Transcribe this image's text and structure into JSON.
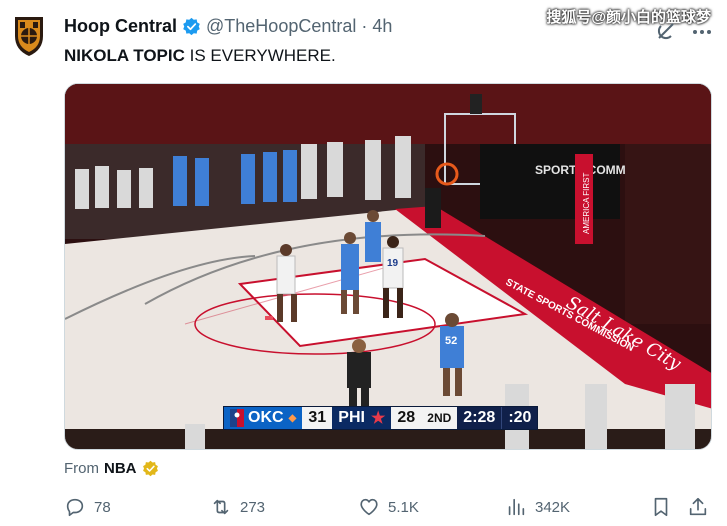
{
  "tweet": {
    "author_name": "Hoop Central",
    "handle": "@TheHoopCentral",
    "separator": "·",
    "time": "4h",
    "text_bold": "NIKOLA TOPIC",
    "text_rest": " IS EVERYWHERE.",
    "watermark": "搜狐号@颜小白的篮球梦"
  },
  "media": {
    "type": "video-frame",
    "scoreboard": {
      "team1": "OKC",
      "score1": "31",
      "team2": "PHI",
      "score2": "28",
      "quarter": "2ND",
      "clock": "2:28",
      "shot_clock": ":20"
    },
    "player_numbers": [
      "19",
      "52"
    ],
    "court_text": [
      "Salt Lake City",
      "AMERICA FIRST",
      "SPORTS COMMISSION",
      "STATE SPORTS COMMISSION"
    ]
  },
  "source": {
    "prefix": "From",
    "name": "NBA"
  },
  "actions": {
    "replies": "78",
    "reposts": "273",
    "likes": "5.1K",
    "views": "342K"
  },
  "colors": {
    "verified_blue": "#1d9bf0",
    "gold_badge": "#e2b719",
    "okc_blue": "#0b63c5",
    "phi_navy": "#0b2a63",
    "court_red": "#c8102e"
  },
  "icons": [
    "team-logo-icon",
    "verified-badge-icon",
    "grok-icon",
    "more-icon",
    "gold-badge-icon",
    "reply-icon",
    "repost-icon",
    "like-icon",
    "views-icon",
    "bookmark-icon",
    "share-icon"
  ]
}
